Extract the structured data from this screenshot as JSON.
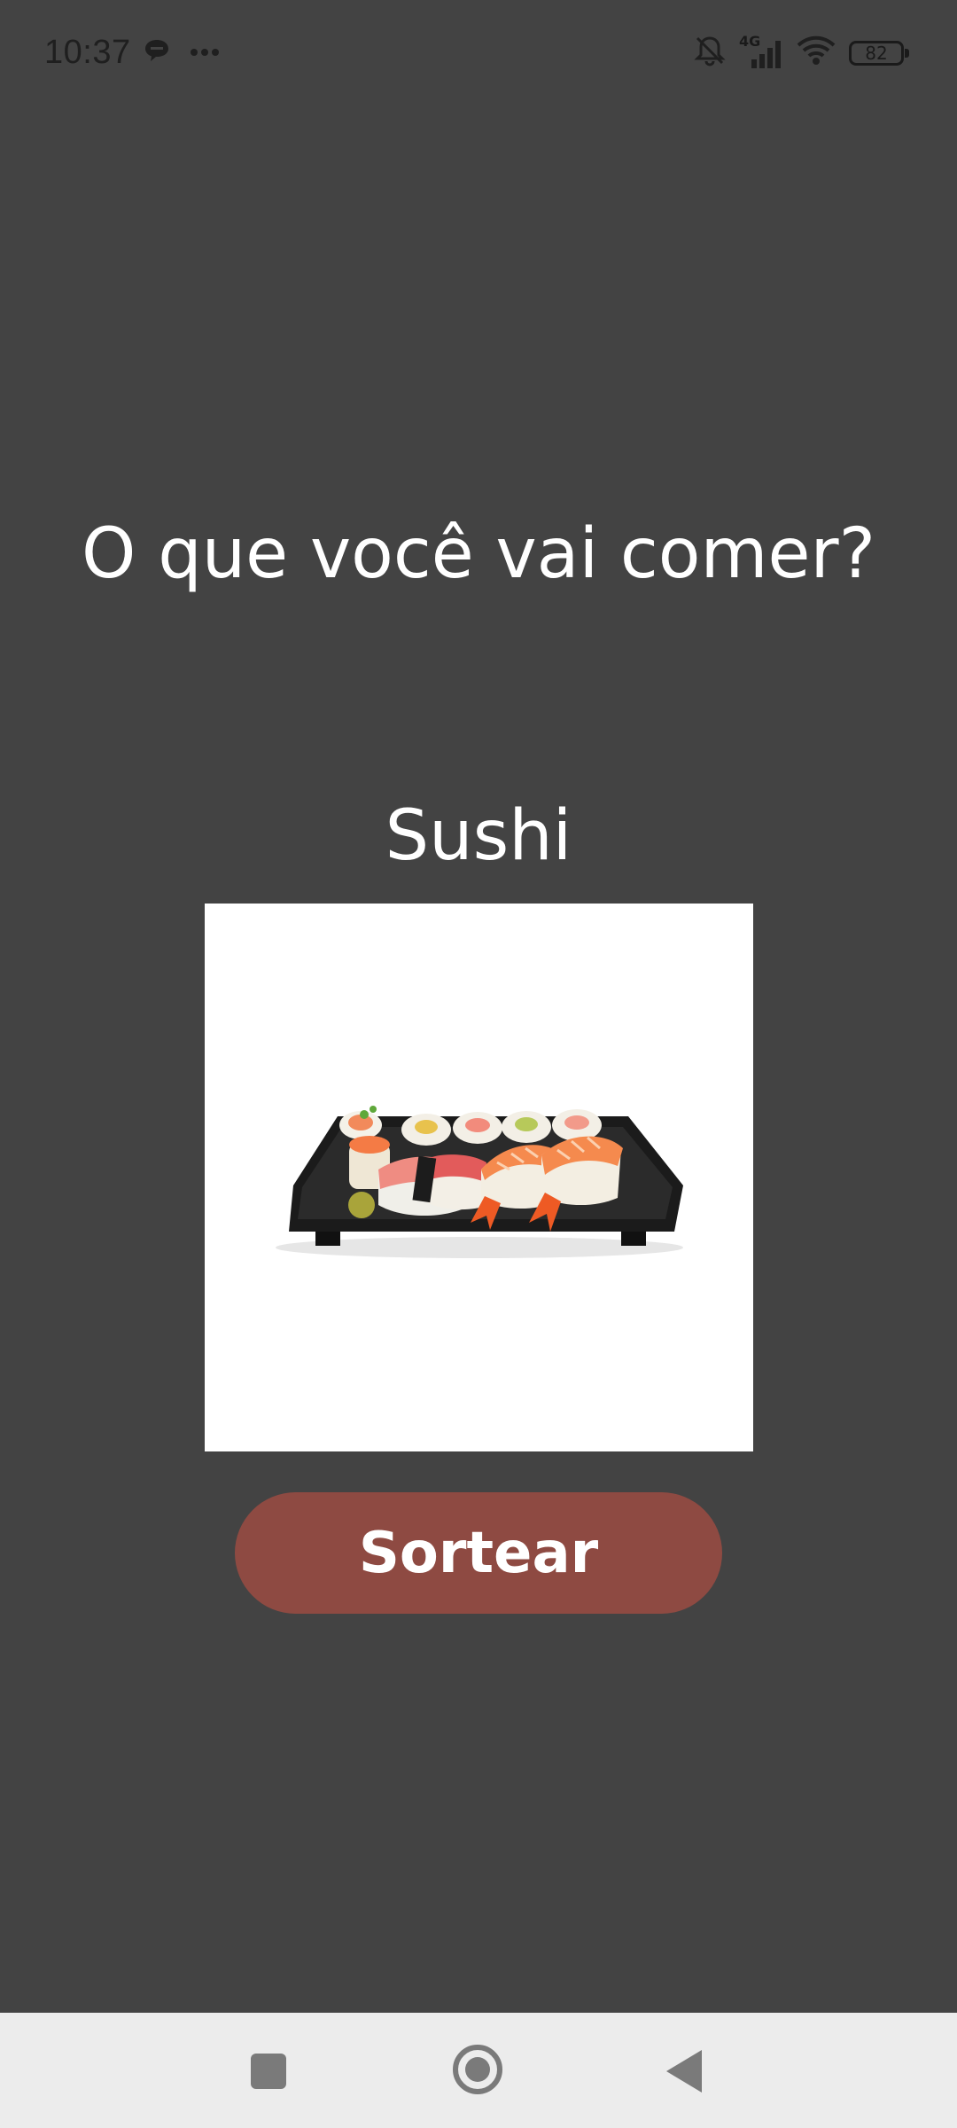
{
  "status_bar": {
    "time": "10:37",
    "network_type": "4G",
    "battery_level": "82",
    "icons": [
      "chat-bubble-icon",
      "more-dots-icon",
      "bell-muted-icon",
      "signal-icon",
      "wifi-icon",
      "battery-icon"
    ]
  },
  "main": {
    "question": "O que você vai comer?",
    "food_name": "Sushi",
    "food_image_subject": "sushi-tray",
    "draw_button_label": "Sortear"
  },
  "navigation": {
    "icons": [
      "recents-square-icon",
      "home-circle-icon",
      "back-triangle-icon"
    ]
  },
  "colors": {
    "background": "#434343",
    "button": "#8e4a42",
    "nav_bar": "#ececec"
  }
}
